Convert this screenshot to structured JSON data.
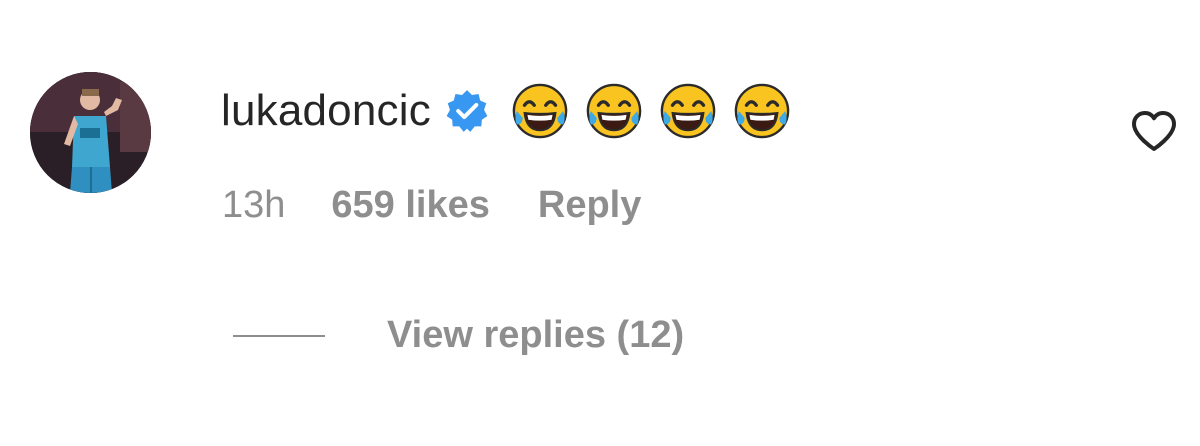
{
  "comment": {
    "username": "lukadoncic",
    "verified": true,
    "emoji_icons": [
      "tears-of-joy-icon",
      "tears-of-joy-icon",
      "tears-of-joy-icon",
      "tears-of-joy-icon"
    ],
    "time": "13h",
    "likes": "659 likes",
    "reply_label": "Reply",
    "view_replies_label": "View replies (12)"
  },
  "colors": {
    "text_primary": "#262626",
    "text_secondary": "#8e8e8e",
    "verified_blue": "#3897f0",
    "emoji_yellow": "#f9c320"
  }
}
